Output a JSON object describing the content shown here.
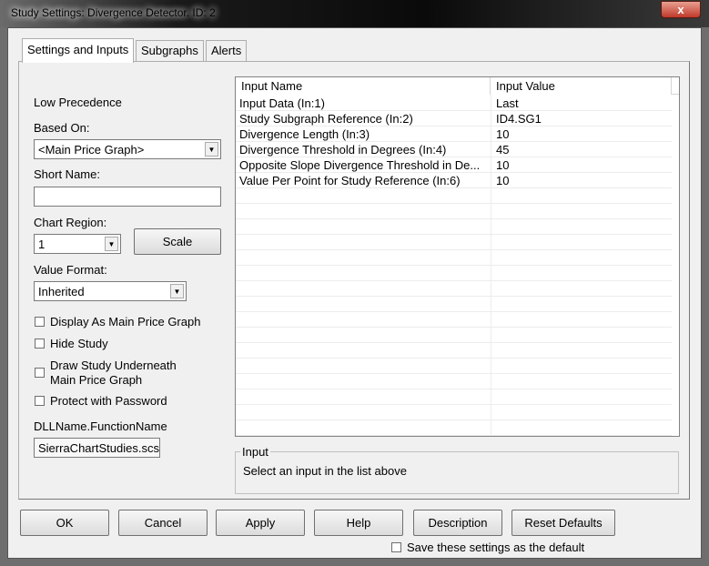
{
  "window": {
    "title": "Study Settings: Divergence Detector. ID: 2",
    "close": "x"
  },
  "tabs": [
    {
      "label": "Settings and Inputs"
    },
    {
      "label": "Subgraphs"
    },
    {
      "label": "Alerts"
    }
  ],
  "left": {
    "precedence": "Low Precedence",
    "based_on_label": "Based On:",
    "based_on_value": "<Main Price Graph>",
    "short_name_label": "Short Name:",
    "short_name_value": "",
    "chart_region_label": "Chart Region:",
    "chart_region_value": "1",
    "scale_button": "Scale",
    "value_format_label": "Value Format:",
    "value_format_value": "Inherited",
    "checkboxes": [
      {
        "label": "Display As Main Price Graph",
        "checked": false
      },
      {
        "label": "Hide Study",
        "checked": false
      },
      {
        "label": "Draw Study Underneath",
        "label2": "Main Price Graph",
        "checked": false
      },
      {
        "label": "Protect with Password",
        "checked": false
      }
    ],
    "dll_label": "DLLName.FunctionName",
    "dll_value": "SierraChartStudies.scs"
  },
  "table": {
    "headers": [
      "Input Name",
      "Input Value"
    ],
    "rows": [
      {
        "name": "Input Data   (In:1)",
        "value": "Last"
      },
      {
        "name": "Study Subgraph Reference   (In:2)",
        "value": "ID4.SG1"
      },
      {
        "name": "Divergence Length   (In:3)",
        "value": "10"
      },
      {
        "name": "Divergence Threshold in Degrees   (In:4)",
        "value": "45"
      },
      {
        "name": "Opposite Slope Divergence Threshold in De...",
        "value": "10"
      },
      {
        "name": "Value Per Point for Study Reference   (In:6)",
        "value": "10"
      }
    ]
  },
  "input_group": {
    "title": "Input",
    "text": "Select an input in the list above"
  },
  "buttons": {
    "ok": "OK",
    "cancel": "Cancel",
    "apply": "Apply",
    "help": "Help",
    "description": "Description",
    "reset": "Reset Defaults"
  },
  "save_default": {
    "label": "Save these settings as the default",
    "checked": false
  }
}
